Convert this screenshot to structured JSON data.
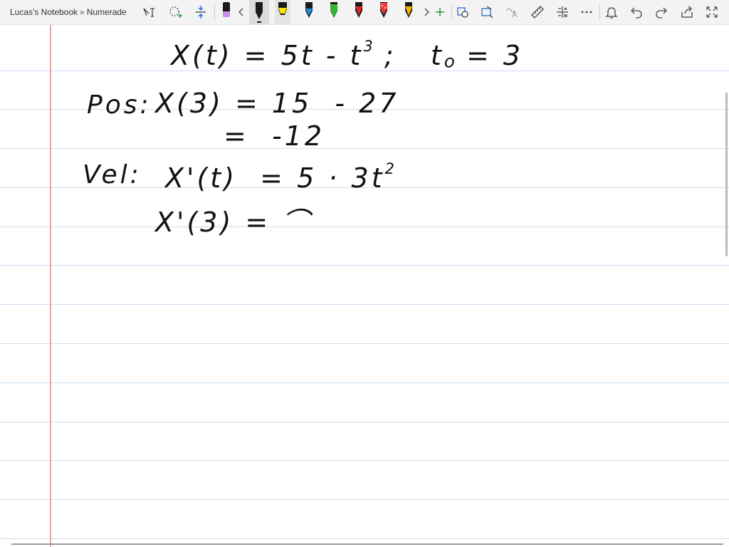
{
  "toolbar": {
    "notebook_name": "Lucas's Notebook",
    "separator": "»",
    "section_name": "Numerade",
    "tools": [
      {
        "name": "text-tool-icon"
      },
      {
        "name": "lasso-select-icon"
      },
      {
        "name": "add-space-icon"
      },
      {
        "name": "eraser-icon"
      },
      {
        "name": "scroll-left-icon"
      }
    ],
    "pens": [
      {
        "name": "pen-black",
        "color": "#1a1a1a",
        "selected": true
      },
      {
        "name": "highlighter-yellow",
        "color": "#f7e400"
      },
      {
        "name": "pen-blue",
        "color": "#1e8fe0"
      },
      {
        "name": "pen-green",
        "color": "#35b332"
      },
      {
        "name": "pen-red",
        "color": "#e0252b"
      },
      {
        "name": "pen-red-galaxy",
        "color": "#e83a3a"
      },
      {
        "name": "pen-gold",
        "color": "#f3b400"
      }
    ],
    "right_tools": [
      {
        "name": "scroll-right-icon"
      },
      {
        "name": "add-pen-icon"
      },
      {
        "name": "shapes-icon"
      },
      {
        "name": "ink-to-shape-icon"
      },
      {
        "name": "ink-to-text-icon"
      },
      {
        "name": "ruler-icon"
      },
      {
        "name": "math-icon"
      },
      {
        "name": "more-icon"
      },
      {
        "name": "notification-icon"
      },
      {
        "name": "undo-icon"
      },
      {
        "name": "redo-icon"
      },
      {
        "name": "share-icon"
      },
      {
        "name": "fullscreen-icon"
      }
    ]
  },
  "colors": {
    "rule_line": "#c8dff2",
    "margin_line": "#e4a7a7",
    "toolbar_bg": "#f3f3f3",
    "accent_green": "#2e9e3e",
    "accent_blue": "#2b6fc7"
  },
  "notes": {
    "line1_left": "X(t) = 5t - t",
    "line1_exp": "3",
    "line1_right": " ;   t",
    "line1_sub": "o",
    "line1_end": " = 3",
    "pos_label": "Pos:",
    "pos_line1": "X(3) = 15  - 27",
    "pos_line2": "=  -12",
    "vel_label": "Vel:",
    "vel_line1_main": "X'(t)  = 5 · 3t",
    "vel_line1_exp": "2",
    "vel_line2": "X'(3) = ⌒"
  }
}
